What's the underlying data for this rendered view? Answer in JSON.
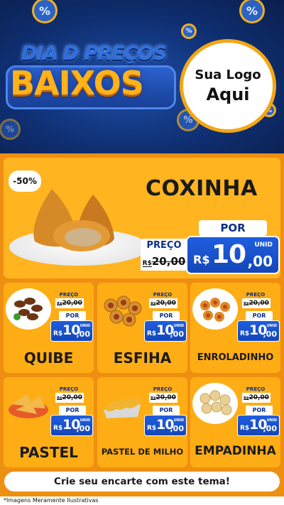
{
  "header": {
    "title_line1": "DIA D PREÇOS",
    "title_line2": "BAIXOS",
    "logo_line1": "Sua Logo",
    "logo_line2": "Aqui",
    "percent_symbol": "%"
  },
  "featured": {
    "discount": "-50%",
    "name": "COXINHA",
    "price_label": "PREÇO",
    "old_currency": "R$",
    "old_price": "20,00",
    "por_label": "POR",
    "currency": "R$",
    "new_int": "10",
    "new_dec": ",00",
    "unit": "UNID"
  },
  "products": [
    {
      "name": "QUIBE",
      "price_label": "PREÇO",
      "old_currency": "R$",
      "old_price": "20,00",
      "por_label": "POR",
      "currency": "R$",
      "new_int": "10",
      "new_dec": ",00",
      "unit": "UNID"
    },
    {
      "name": "ESFIHA",
      "price_label": "PREÇO",
      "old_currency": "R$",
      "old_price": "20,00",
      "por_label": "POR",
      "currency": "R$",
      "new_int": "10",
      "new_dec": ",00",
      "unit": "UNID"
    },
    {
      "name": "ENROLADINHO",
      "price_label": "PREÇO",
      "old_currency": "R$",
      "old_price": "20,00",
      "por_label": "POR",
      "currency": "R$",
      "new_int": "10",
      "new_dec": ",00",
      "unit": "UNID"
    },
    {
      "name": "PASTEL",
      "price_label": "PREÇO",
      "old_currency": "R$",
      "old_price": "20,00",
      "por_label": "POR",
      "currency": "R$",
      "new_int": "10",
      "new_dec": ",00",
      "unit": "UNID"
    },
    {
      "name": "PASTEL DE MILHO",
      "price_label": "PREÇO",
      "old_currency": "R$",
      "old_price": "20,00",
      "por_label": "POR",
      "currency": "R$",
      "new_int": "10",
      "new_dec": ",00",
      "unit": "UNID"
    },
    {
      "name": "EMPADINHA",
      "price_label": "PREÇO",
      "old_currency": "R$",
      "old_price": "20,00",
      "por_label": "POR",
      "currency": "R$",
      "new_int": "10",
      "new_dec": ",00",
      "unit": "UNID"
    }
  ],
  "cta": "Crie seu encarte com este tema!",
  "footnote": "*Imagens Meramente Ilustrativas",
  "colors": {
    "header_blue": "#0f2f72",
    "orange_bg": "#ef8f12",
    "card_yellow": "#ffad14",
    "price_blue": "#1a52cc",
    "title_gold": "#ffb31a"
  }
}
